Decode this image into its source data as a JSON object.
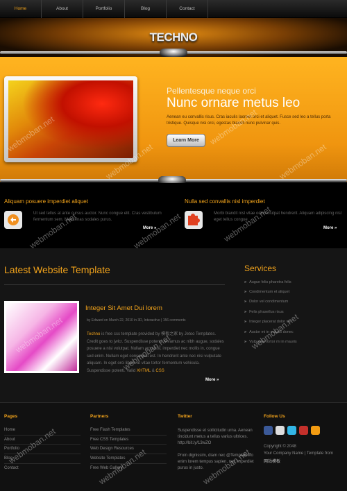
{
  "nav": {
    "items": [
      "Home",
      "About",
      "Portfolio",
      "Blog",
      "Contact"
    ]
  },
  "logo": "TECHNO",
  "hero": {
    "subtitle": "Pellentesque neque orci",
    "title": "Nunc ornare metus leo",
    "text": "Aenean eu convallis risus. Cras iaculis laoreet orci et aliquet. Fusce sed leo a tellus porta tristique. Quisque nisi orci, egestas blandit nunc pulvinar quis.",
    "button": "Learn More"
  },
  "features": [
    {
      "title": "Aliquam posuere imperdiet aliquet",
      "text": "Ut sed tellus at ante cursus auctor. Nunc congue elit. Cras vestibulum fermentum sem. Maecenas sodales purus.",
      "more": "More"
    },
    {
      "title": "Nulla sed convallis nisl imperdiet",
      "text": "Morbi blandit nisl vitae odio volutpat hendrerit. Aliquam adipiscing nisl eget tellus congue.",
      "more": "More"
    }
  ],
  "main": {
    "title": "Latest Website Template",
    "post": {
      "title": "Integer Sit Amet Dui lorem",
      "meta": "by Edward on March 22, 2010 in 3D, Interactive | 156 comments",
      "text_intro": "Techno",
      "text_body": " is free css template provided by 模板之家 by Jetoo Templates. Credit goes to jwlcr. Suspendisse potenti. Vivamus ac nibh augue, sodales posuere a nisi volutpat. Nullam arcu nisl, imperdiet nec mollis in, congue sed enim. Nullam eget consequat est. In hendrerit ante nec nisi vulputate aliquam. In eget orci libero ut vitae tortor fermentum vehicula. Suspendisse potenti. Valid ",
      "xhtml": "XHTML",
      "amp": " & ",
      "css": "CSS",
      "more": "More"
    }
  },
  "services": {
    "title": "Services",
    "items": [
      "Augue felis pharetra felis",
      "Condimentum et aliquet",
      "Dolor vel condimentum",
      "Felis phasellus risus",
      "Integer placerat dolor vel",
      "Auctor mi in mauris donec",
      "Vulputate tortor mi in mauris"
    ]
  },
  "footer": {
    "pages": {
      "title": "Pages",
      "items": [
        "Home",
        "About",
        "Portfolio",
        "Blog",
        "Contact"
      ]
    },
    "partners": {
      "title": "Partners",
      "items": [
        "Free Flash Templates",
        "Free CSS Templates",
        "Web Design Resources",
        "Website Templates",
        "Free Web Gallery"
      ]
    },
    "twitter": {
      "title": "Twitter",
      "tweet1": "Suspendisse et sollicitudin urna. Aenean tincidunt metus a tellus varius ultrices. http://bit.ly/13wZO",
      "tweet2": "Proin dignissim, diam nec @TemplateMo enim lorem tempus sapien, nec imperdiet purus in justo."
    },
    "follow": {
      "title": "Follow Us",
      "copyright": "Copyright © 2048",
      "company": "Your Company Name | Template from",
      "site": "网站模板"
    }
  },
  "watermark": "webmoban.net",
  "colors": {
    "accent": "#f3a41b",
    "bg": "#151515"
  }
}
